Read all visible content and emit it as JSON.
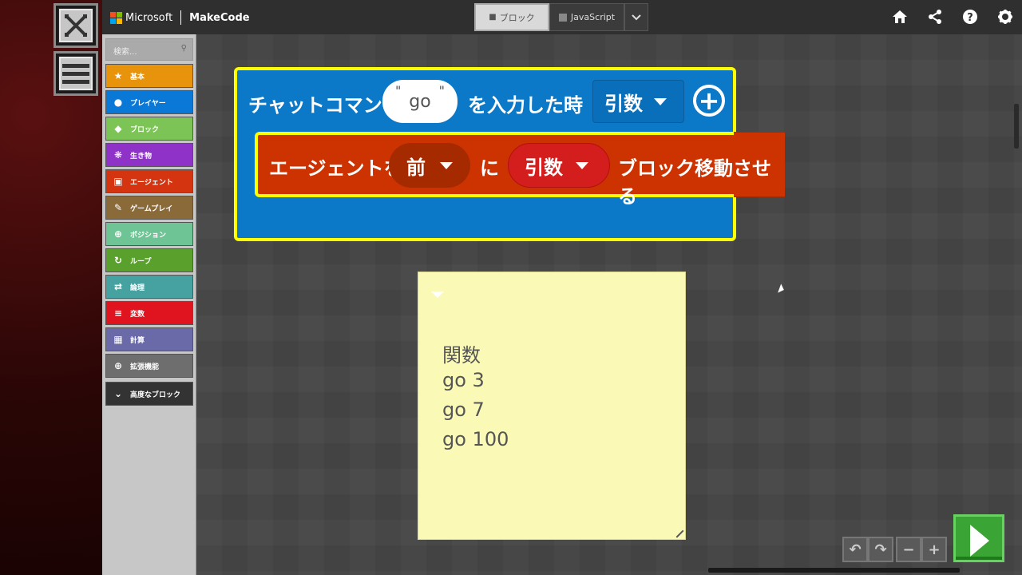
{
  "brand": {
    "company": "Microsoft",
    "product": "MakeCode"
  },
  "tabs": {
    "blocks": "ブロック",
    "javascript": "JavaScript"
  },
  "search": {
    "placeholder": "検索..."
  },
  "categories": [
    {
      "label": "基本",
      "color": "#e8930c",
      "icon": "star-icon"
    },
    {
      "label": "プレイヤー",
      "color": "#0a78d6",
      "icon": "user-icon"
    },
    {
      "label": "ブロック",
      "color": "#7bc455",
      "icon": "cube-icon"
    },
    {
      "label": "生き物",
      "color": "#8e32c8",
      "icon": "paw-icon"
    },
    {
      "label": "エージェント",
      "color": "#d43410",
      "icon": "agent-icon"
    },
    {
      "label": "ゲームプレイ",
      "color": "#8b6a3a",
      "icon": "wrench-icon"
    },
    {
      "label": "ポジション",
      "color": "#6ec495",
      "icon": "crosshair-icon"
    },
    {
      "label": "ループ",
      "color": "#5aa02c",
      "icon": "loop-icon"
    },
    {
      "label": "論理",
      "color": "#46a2a0",
      "icon": "shuffle-icon"
    },
    {
      "label": "変数",
      "color": "#e0141e",
      "icon": "list-icon"
    },
    {
      "label": "計算",
      "color": "#6a6aa8",
      "icon": "calculator-icon"
    },
    {
      "label": "拡張機能",
      "color": "#6e6e6e",
      "icon": "plus-circle-icon"
    },
    {
      "label": "高度なブロック",
      "color": "#333333",
      "icon": "chevron-down-icon"
    }
  ],
  "event_block": {
    "title": "チャットコマンド",
    "command_value": "go",
    "suffix": "を入力した時",
    "param_dropdown": "引数"
  },
  "agent_block": {
    "prefix": "エージェントを",
    "direction": "前",
    "particle": "に",
    "amount": "引数",
    "suffix": "ブロック移動させる"
  },
  "note": {
    "lines": [
      "関数",
      "go 3",
      "go 7",
      "go 100"
    ]
  }
}
